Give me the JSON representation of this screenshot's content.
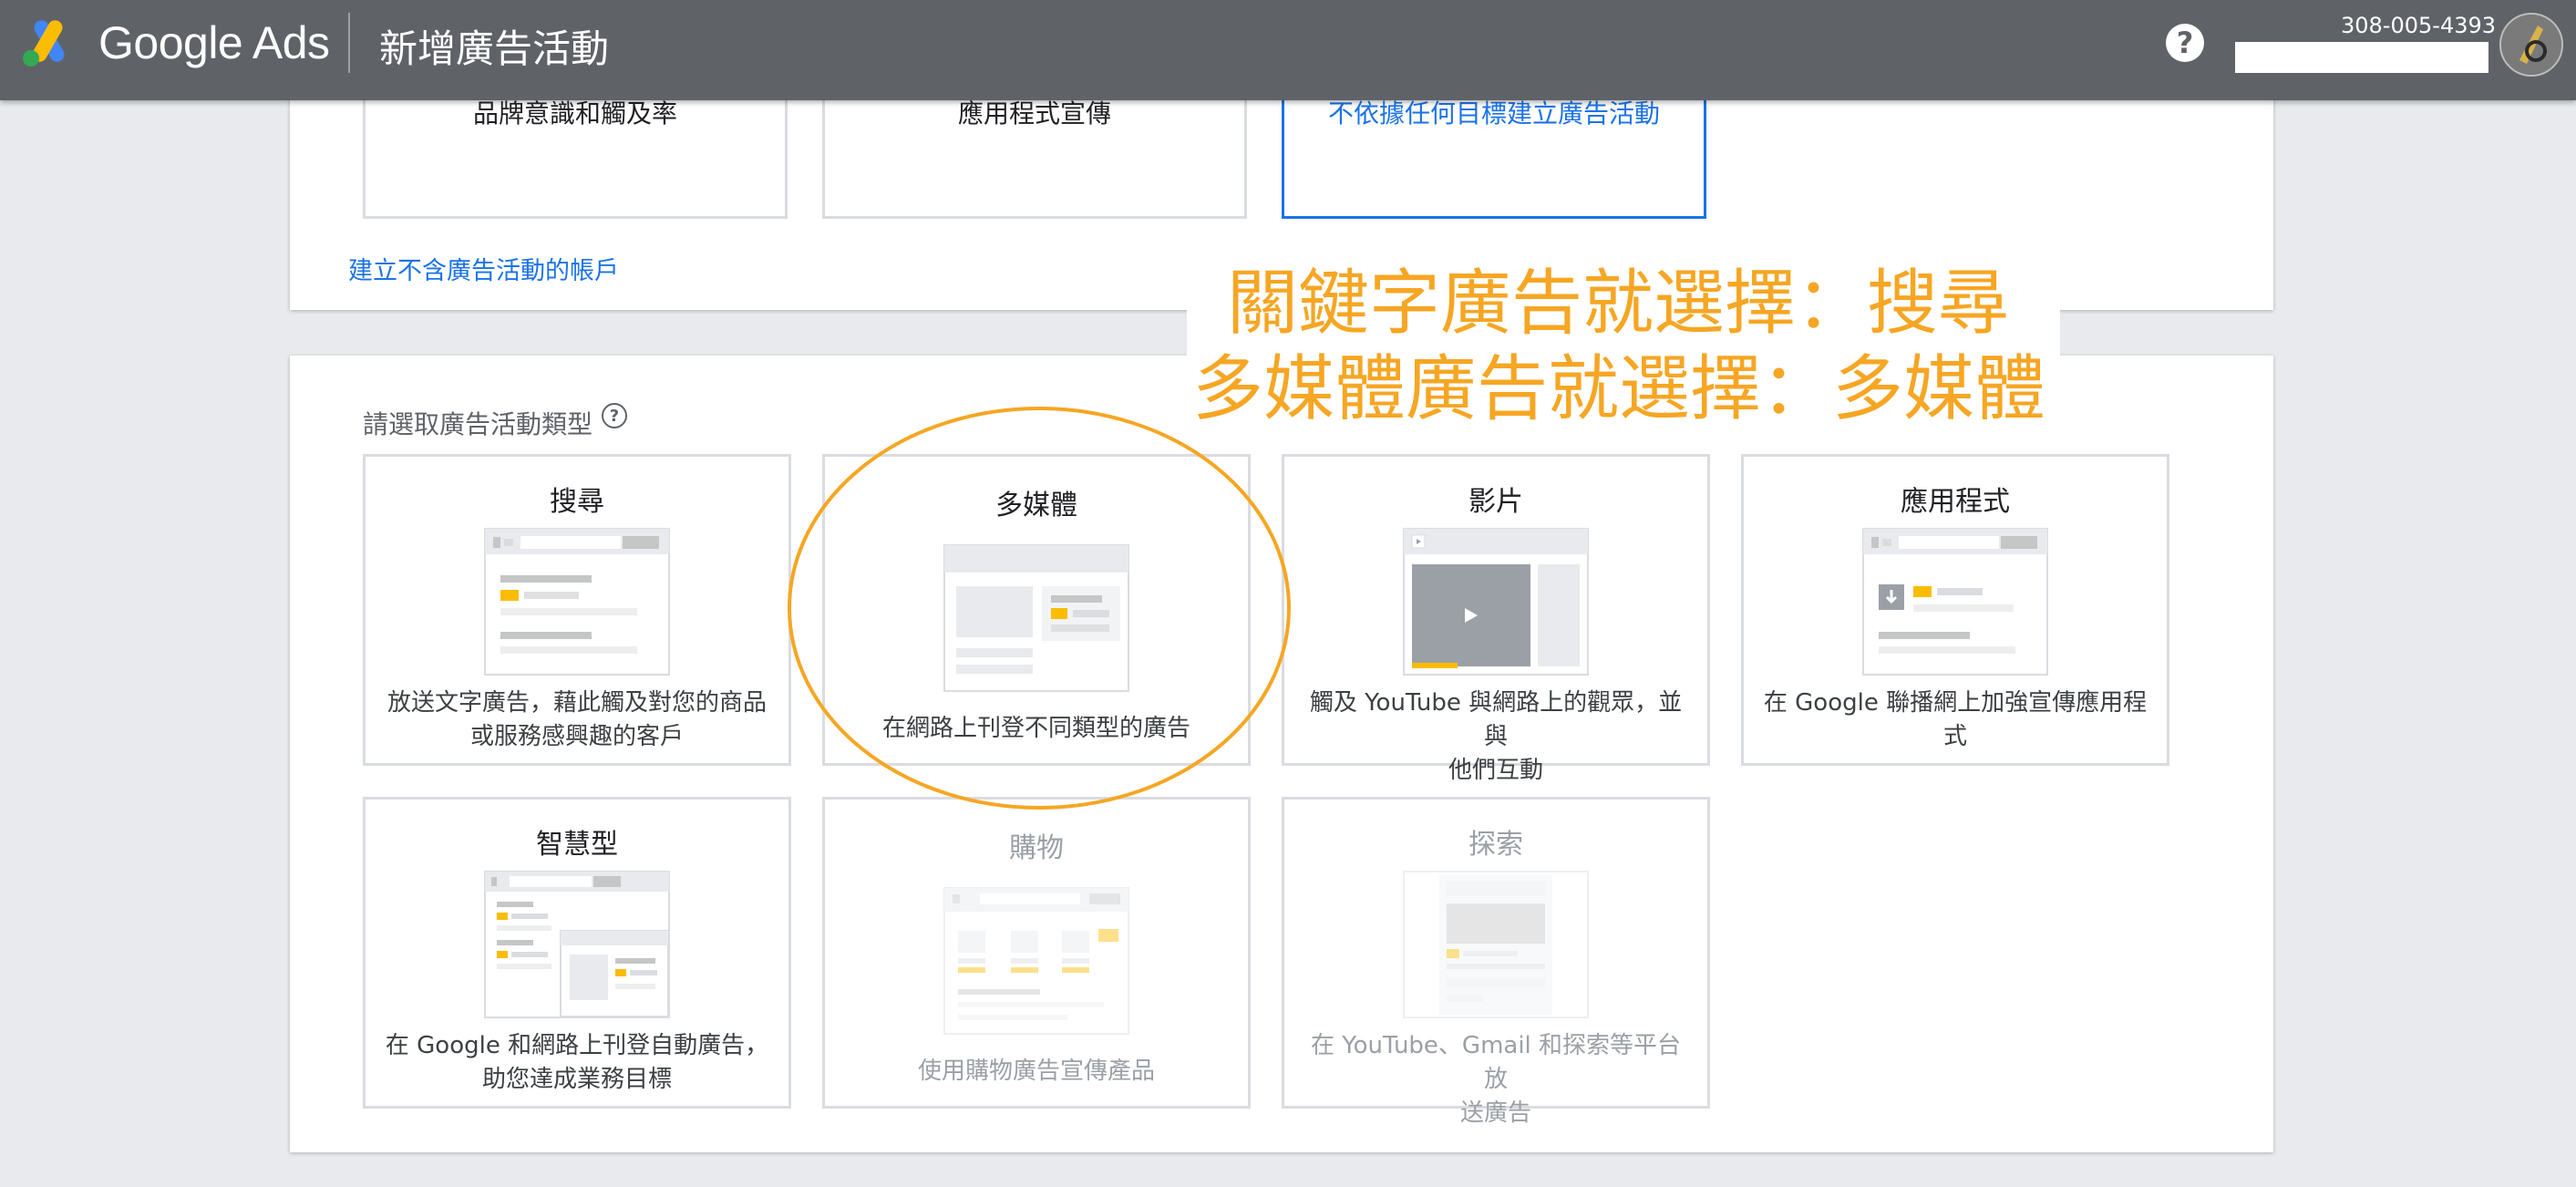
{
  "topbar": {
    "brand": "Google Ads",
    "page_title": "新增廣告活動",
    "help_icon": "help-icon",
    "account_id": "308-005-4393"
  },
  "goals": [
    {
      "label": "品牌意識和觸及率",
      "selected": false
    },
    {
      "label": "應用程式宣傳",
      "selected": false
    },
    {
      "label": "不依據任何目標建立廣告活動",
      "selected": true
    }
  ],
  "link_no_campaign": "建立不含廣告活動的帳戶",
  "campaign_type_section": {
    "label": "請選取廣告活動類型",
    "info_icon": "help-outline-icon"
  },
  "campaign_types": [
    {
      "title": "搜尋",
      "desc_lines": [
        "放送文字廣告，藉此觸及對您的商品",
        "或服務感興趣的客戶"
      ],
      "enabled": true,
      "illustration": "search-ad-illustration"
    },
    {
      "title": "多媒體",
      "desc_lines": [
        "在網路上刊登不同類型的廣告"
      ],
      "enabled": true,
      "illustration": "display-ad-illustration"
    },
    {
      "title": "影片",
      "desc_lines": [
        "觸及 YouTube 與網路上的觀眾，並與",
        "他們互動"
      ],
      "enabled": true,
      "illustration": "video-ad-illustration"
    },
    {
      "title": "應用程式",
      "desc_lines": [
        "在 Google 聯播網上加強宣傳應用程",
        "式"
      ],
      "enabled": true,
      "illustration": "app-ad-illustration"
    },
    {
      "title": "智慧型",
      "desc_lines": [
        "在 Google 和網路上刊登自動廣告，",
        "助您達成業務目標"
      ],
      "enabled": true,
      "illustration": "smart-ad-illustration"
    },
    {
      "title": "購物",
      "desc_lines": [
        "使用購物廣告宣傳產品"
      ],
      "enabled": false,
      "illustration": "shopping-ad-illustration"
    },
    {
      "title": "探索",
      "desc_lines": [
        "在 YouTube、Gmail 和探索等平台放",
        "送廣告"
      ],
      "enabled": false,
      "illustration": "discovery-ad-illustration"
    }
  ],
  "annotation": {
    "line1": "關鍵字廣告就選擇：搜尋",
    "line2": "多媒體廣告就選擇：多媒體",
    "color": "#f6a623"
  },
  "colors": {
    "topbar": "#5f6368",
    "accent_blue": "#1a73e8",
    "ad_yellow": "#fbbc04"
  }
}
